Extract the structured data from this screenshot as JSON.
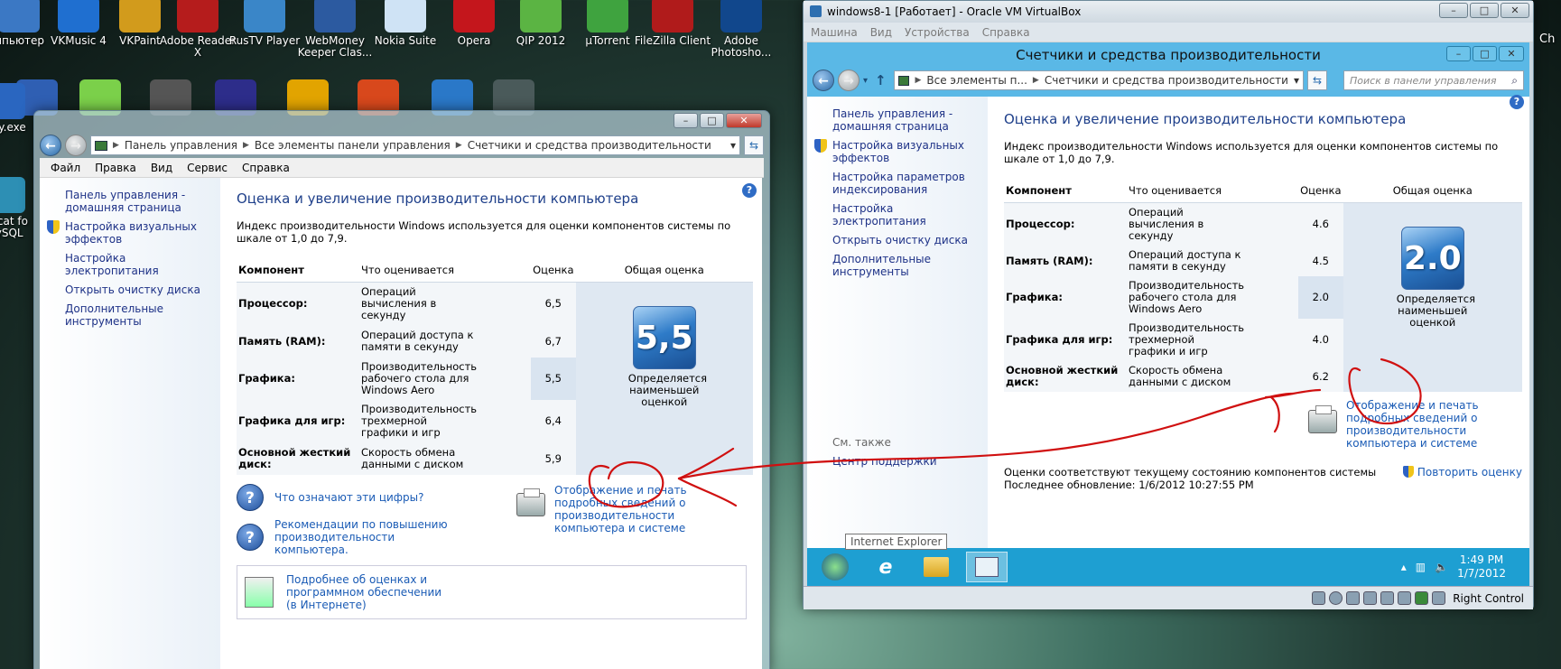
{
  "desktop": {
    "icons_top": [
      {
        "label": "мпьютер",
        "icon": "computer-icon"
      },
      {
        "label": "VKMusic 4",
        "icon": "music-note-icon"
      },
      {
        "label": "VKPaint",
        "icon": "paint-brush-icon"
      },
      {
        "label": "Adobe Reader X",
        "icon": "pdf-icon"
      },
      {
        "label": "RusTV Player",
        "icon": "tv-icon"
      },
      {
        "label": "WebMoney Keeper Clas...",
        "icon": "webmoney-icon"
      },
      {
        "label": "Nokia Suite",
        "icon": "nokia-icon"
      },
      {
        "label": "Opera",
        "icon": "opera-icon"
      },
      {
        "label": "QIP 2012",
        "icon": "qip-icon"
      },
      {
        "label": "µTorrent",
        "icon": "utorrent-icon"
      },
      {
        "label": "FileZilla Client",
        "icon": "filezilla-icon"
      },
      {
        "label": "Adobe Photosho...",
        "icon": "photoshop-icon"
      }
    ],
    "icons_left": [
      {
        "label": "utty.exe",
        "icon": "putty-icon"
      },
      {
        "label": "avicat fo MySQL",
        "icon": "navicat-icon"
      }
    ],
    "right_edge_label": "Ch"
  },
  "win7": {
    "breadcrumb": [
      "Панель управления",
      "Все элементы панели управления",
      "Счетчики и средства производительности"
    ],
    "menu": [
      "Файл",
      "Правка",
      "Вид",
      "Сервис",
      "Справка"
    ],
    "sidebar": [
      {
        "label": "Панель управления - домашняя страница",
        "shield": false
      },
      {
        "label": "Настройка визуальных эффектов",
        "shield": true
      },
      {
        "label": "Настройка электропитания",
        "shield": false
      },
      {
        "label": "Открыть очистку диска",
        "shield": false
      },
      {
        "label": "Дополнительные инструменты",
        "shield": false
      }
    ],
    "heading": "Оценка и увеличение производительности компьютера",
    "description": "Индекс производительности Windows используется для оценки компонентов системы по шкале от 1,0 до 7,9.",
    "table": {
      "headers": [
        "Компонент",
        "Что оценивается",
        "Оценка",
        "Общая оценка"
      ],
      "rows": [
        {
          "component": "Процессор:",
          "what": "Операций вычисления в секунду",
          "score": "6,5",
          "highlight": false
        },
        {
          "component": "Память (RAM):",
          "what": "Операций доступа к памяти в секунду",
          "score": "6,7",
          "highlight": false
        },
        {
          "component": "Графика:",
          "what": "Производительность рабочего стола для Windows Aero",
          "score": "5,5",
          "highlight": true
        },
        {
          "component": "Графика для игр:",
          "what": "Производительность трехмерной графики и игр",
          "score": "6,4",
          "highlight": false
        },
        {
          "component": "Основной жесткий диск:",
          "what": "Скорость обмена данными с диском",
          "score": "5,9",
          "highlight": false
        }
      ],
      "base_score": "5,5",
      "base_caption": "Определяется наименьшей оценкой"
    },
    "help_links": [
      {
        "label": "Что означают эти цифры?"
      },
      {
        "label": "Рекомендации по повышению производительности компьютера."
      }
    ],
    "print_link": "Отображение и печать подробных сведений о производительности компьютера и системе",
    "more_info": "Подробнее об оценках и программном обеспечении (в Интернете)"
  },
  "win8": {
    "title": "windows8-1 [Работает] - Oracle VM VirtualBox",
    "vbox_menu": [
      "Машина",
      "Вид",
      "Устройства",
      "Справка"
    ],
    "inner_title": "Счетчики и средства производительности",
    "breadcrumb": [
      "Все элементы п...",
      "Счетчики и средства производительности"
    ],
    "search_placeholder": "Поиск в панели управления",
    "sidebar": [
      {
        "label": "Панель управления - домашняя страница",
        "shield": false
      },
      {
        "label": "Настройка визуальных эффектов",
        "shield": true
      },
      {
        "label": "Настройка параметров индексирования",
        "shield": false
      },
      {
        "label": "Настройка электропитания",
        "shield": false
      },
      {
        "label": "Открыть очистку диска",
        "shield": false
      },
      {
        "label": "Дополнительные инструменты",
        "shield": false
      }
    ],
    "see_also_label": "См. также",
    "support_center": "Центр поддержки",
    "tooltip": "Internet Explorer",
    "heading": "Оценка и увеличение производительности компьютера",
    "description": "Индекс производительности Windows используется для оценки компонентов системы по шкале от 1,0 до 7,9.",
    "table": {
      "headers": [
        "Компонент",
        "Что оценивается",
        "Оценка",
        "Общая оценка"
      ],
      "rows": [
        {
          "component": "Процессор:",
          "what": "Операций вычисления в секунду",
          "score": "4.6",
          "highlight": false
        },
        {
          "component": "Память (RAM):",
          "what": "Операций доступа к памяти в секунду",
          "score": "4.5",
          "highlight": false
        },
        {
          "component": "Графика:",
          "what": "Производительность рабочего стола для Windows Aero",
          "score": "2.0",
          "highlight": true
        },
        {
          "component": "Графика для игр:",
          "what": "Производительность трехмерной графики и игр",
          "score": "4.0",
          "highlight": false
        },
        {
          "component": "Основной жесткий диск:",
          "what": "Скорость обмена данными с диском",
          "score": "6.2",
          "highlight": false
        }
      ],
      "base_score": "2.0",
      "base_caption": "Определяется наименьшей оценкой"
    },
    "print_link": "Отображение и печать подробных сведений о производительности компьютера и системе",
    "status_line": "Оценки соответствуют текущему состоянию компонентов системы",
    "last_update": "Последнее обновление: 1/6/2012 10:27:55 PM",
    "rerun": "Повторить оценку",
    "clock_time": "1:49 PM",
    "clock_date": "1/7/2012",
    "host_key": "Right Control"
  },
  "colors": {
    "annotation": "#d01010",
    "link": "#1a5bb5",
    "win8_taskbar": "#1e9fd2"
  }
}
